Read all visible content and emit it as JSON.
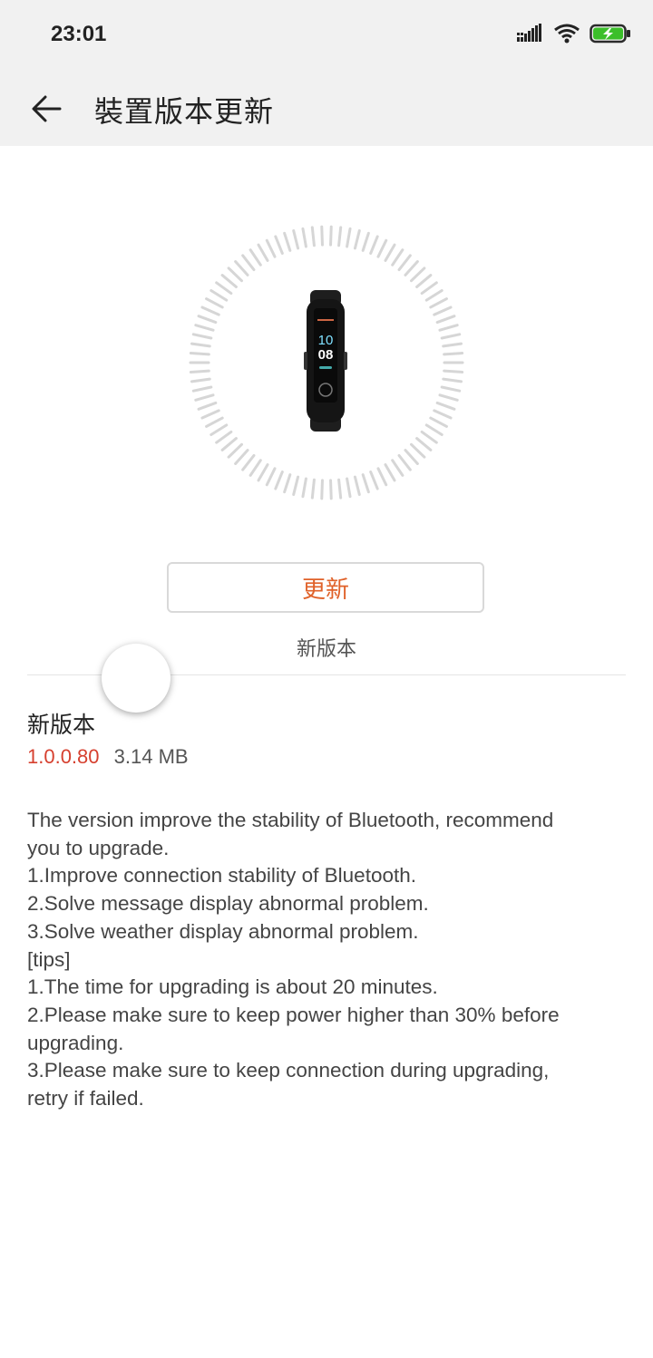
{
  "status_bar": {
    "time": "23:01",
    "icons": [
      "signal-icon",
      "wifi-icon",
      "battery-charging-icon"
    ]
  },
  "app_bar": {
    "back_icon": "back-arrow-icon",
    "title": "裝置版本更新"
  },
  "hero": {
    "device_image": "smart-band-image",
    "band_screen_time": "10\n08"
  },
  "actions": {
    "update_label": "更新",
    "state_text": "新版本"
  },
  "details": {
    "section_title": "新版本",
    "version": "1.0.0.80",
    "size": "3.14 MB",
    "notes": [
      "The version improve the stability of Bluetooth, recommend",
      "you to upgrade.",
      "1.Improve connection stability of Bluetooth.",
      "2.Solve message display abnormal problem.",
      "3.Solve weather display abnormal problem.",
      "[tips]",
      "1.The time for upgrading is about 20 minutes.",
      "2.Please make sure to keep power higher than 30% before",
      "upgrading.",
      "3.Please make sure to keep connection during upgrading,",
      "retry if failed."
    ]
  },
  "colors": {
    "accent_orange": "#e0622a",
    "version_red": "#d6402f",
    "bar_bg": "#f1f1f1"
  }
}
